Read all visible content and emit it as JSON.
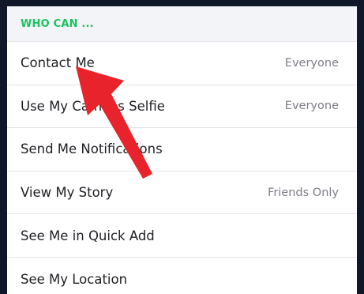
{
  "colors": {
    "background": "#101728",
    "panel": "#ffffff",
    "header_bg": "#f3f4f7",
    "header_text": "#19c35d",
    "divider": "#e3e4e8",
    "label_text": "#1f1f24",
    "value_text": "#7d7f87",
    "annotation_arrow": "#e8232b"
  },
  "section": {
    "title": "WHO CAN ..."
  },
  "rows": [
    {
      "label": "Contact Me",
      "value": "Everyone"
    },
    {
      "label": "Use My Cameos Selfie",
      "value": "Everyone"
    },
    {
      "label": "Send Me Notifications",
      "value": ""
    },
    {
      "label": "View My Story",
      "value": "Friends Only"
    },
    {
      "label": "See Me in Quick Add",
      "value": ""
    },
    {
      "label": "See My Location",
      "value": ""
    }
  ],
  "annotation": {
    "icon": "red-pointer-arrow",
    "target": "Contact Me"
  }
}
